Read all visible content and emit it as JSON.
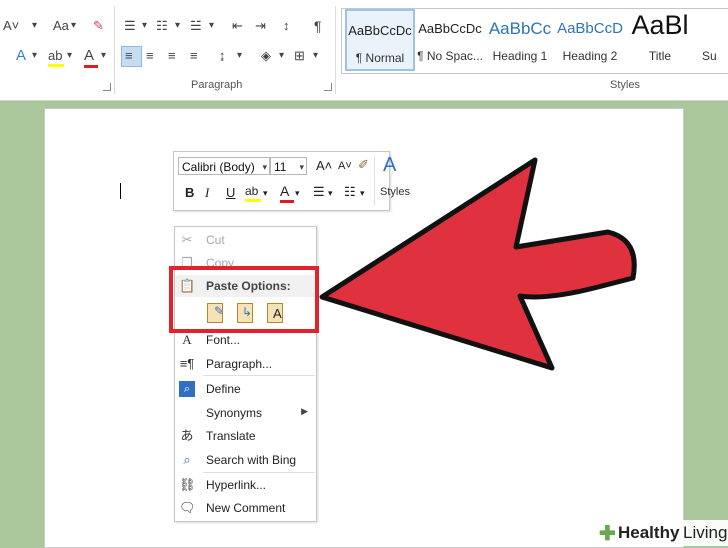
{
  "ribbon": {
    "font_group": {
      "size_button": "Aa"
    },
    "paragraph_group": {
      "label": "Paragraph",
      "pilcrow": "¶"
    },
    "styles_group": {
      "label": "Styles",
      "items": [
        {
          "preview": "AaBbCcDc",
          "name": "¶ Normal",
          "selected": true
        },
        {
          "preview": "AaBbCcDc",
          "name": "¶ No Spac..."
        },
        {
          "preview": "AaBbCc",
          "name": "Heading 1"
        },
        {
          "preview": "AaBbCcD",
          "name": "Heading 2"
        },
        {
          "preview": "AaBl",
          "name": "Title"
        },
        {
          "preview": "",
          "name": "Su"
        }
      ]
    }
  },
  "mini_toolbar": {
    "font_name": "Calibri (Body)",
    "font_size": "11",
    "styles_label": "Styles",
    "buttons": {
      "bold": "B",
      "italic": "I",
      "underline": "U"
    },
    "colors": {
      "highlight": "#ffff00",
      "font_color": "#e01b24"
    }
  },
  "context_menu": {
    "cut": "Cut",
    "copy": "Copy",
    "paste_options": "Paste Options:",
    "font": "Font...",
    "paragraph": "Paragraph...",
    "define": "Define",
    "synonyms": "Synonyms",
    "translate": "Translate",
    "search": "Search with Bing",
    "hyperlink": "Hyperlink...",
    "new_comment": "New Comment"
  },
  "colors": {
    "arrow_fill": "#e0323e",
    "highlight_box": "#e0232e",
    "background": "#a9c79a"
  },
  "watermark": {
    "brand": "Healthy",
    "brand2": "Living"
  }
}
